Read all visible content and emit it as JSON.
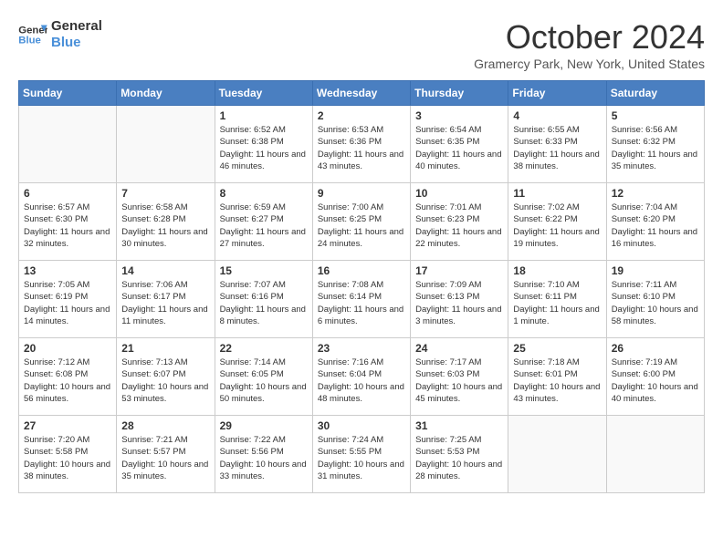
{
  "header": {
    "logo_line1": "General",
    "logo_line2": "Blue",
    "month": "October 2024",
    "location": "Gramercy Park, New York, United States"
  },
  "weekdays": [
    "Sunday",
    "Monday",
    "Tuesday",
    "Wednesday",
    "Thursday",
    "Friday",
    "Saturday"
  ],
  "weeks": [
    [
      {
        "day": "",
        "info": ""
      },
      {
        "day": "",
        "info": ""
      },
      {
        "day": "1",
        "info": "Sunrise: 6:52 AM\nSunset: 6:38 PM\nDaylight: 11 hours and 46 minutes."
      },
      {
        "day": "2",
        "info": "Sunrise: 6:53 AM\nSunset: 6:36 PM\nDaylight: 11 hours and 43 minutes."
      },
      {
        "day": "3",
        "info": "Sunrise: 6:54 AM\nSunset: 6:35 PM\nDaylight: 11 hours and 40 minutes."
      },
      {
        "day": "4",
        "info": "Sunrise: 6:55 AM\nSunset: 6:33 PM\nDaylight: 11 hours and 38 minutes."
      },
      {
        "day": "5",
        "info": "Sunrise: 6:56 AM\nSunset: 6:32 PM\nDaylight: 11 hours and 35 minutes."
      }
    ],
    [
      {
        "day": "6",
        "info": "Sunrise: 6:57 AM\nSunset: 6:30 PM\nDaylight: 11 hours and 32 minutes."
      },
      {
        "day": "7",
        "info": "Sunrise: 6:58 AM\nSunset: 6:28 PM\nDaylight: 11 hours and 30 minutes."
      },
      {
        "day": "8",
        "info": "Sunrise: 6:59 AM\nSunset: 6:27 PM\nDaylight: 11 hours and 27 minutes."
      },
      {
        "day": "9",
        "info": "Sunrise: 7:00 AM\nSunset: 6:25 PM\nDaylight: 11 hours and 24 minutes."
      },
      {
        "day": "10",
        "info": "Sunrise: 7:01 AM\nSunset: 6:23 PM\nDaylight: 11 hours and 22 minutes."
      },
      {
        "day": "11",
        "info": "Sunrise: 7:02 AM\nSunset: 6:22 PM\nDaylight: 11 hours and 19 minutes."
      },
      {
        "day": "12",
        "info": "Sunrise: 7:04 AM\nSunset: 6:20 PM\nDaylight: 11 hours and 16 minutes."
      }
    ],
    [
      {
        "day": "13",
        "info": "Sunrise: 7:05 AM\nSunset: 6:19 PM\nDaylight: 11 hours and 14 minutes."
      },
      {
        "day": "14",
        "info": "Sunrise: 7:06 AM\nSunset: 6:17 PM\nDaylight: 11 hours and 11 minutes."
      },
      {
        "day": "15",
        "info": "Sunrise: 7:07 AM\nSunset: 6:16 PM\nDaylight: 11 hours and 8 minutes."
      },
      {
        "day": "16",
        "info": "Sunrise: 7:08 AM\nSunset: 6:14 PM\nDaylight: 11 hours and 6 minutes."
      },
      {
        "day": "17",
        "info": "Sunrise: 7:09 AM\nSunset: 6:13 PM\nDaylight: 11 hours and 3 minutes."
      },
      {
        "day": "18",
        "info": "Sunrise: 7:10 AM\nSunset: 6:11 PM\nDaylight: 11 hours and 1 minute."
      },
      {
        "day": "19",
        "info": "Sunrise: 7:11 AM\nSunset: 6:10 PM\nDaylight: 10 hours and 58 minutes."
      }
    ],
    [
      {
        "day": "20",
        "info": "Sunrise: 7:12 AM\nSunset: 6:08 PM\nDaylight: 10 hours and 56 minutes."
      },
      {
        "day": "21",
        "info": "Sunrise: 7:13 AM\nSunset: 6:07 PM\nDaylight: 10 hours and 53 minutes."
      },
      {
        "day": "22",
        "info": "Sunrise: 7:14 AM\nSunset: 6:05 PM\nDaylight: 10 hours and 50 minutes."
      },
      {
        "day": "23",
        "info": "Sunrise: 7:16 AM\nSunset: 6:04 PM\nDaylight: 10 hours and 48 minutes."
      },
      {
        "day": "24",
        "info": "Sunrise: 7:17 AM\nSunset: 6:03 PM\nDaylight: 10 hours and 45 minutes."
      },
      {
        "day": "25",
        "info": "Sunrise: 7:18 AM\nSunset: 6:01 PM\nDaylight: 10 hours and 43 minutes."
      },
      {
        "day": "26",
        "info": "Sunrise: 7:19 AM\nSunset: 6:00 PM\nDaylight: 10 hours and 40 minutes."
      }
    ],
    [
      {
        "day": "27",
        "info": "Sunrise: 7:20 AM\nSunset: 5:58 PM\nDaylight: 10 hours and 38 minutes."
      },
      {
        "day": "28",
        "info": "Sunrise: 7:21 AM\nSunset: 5:57 PM\nDaylight: 10 hours and 35 minutes."
      },
      {
        "day": "29",
        "info": "Sunrise: 7:22 AM\nSunset: 5:56 PM\nDaylight: 10 hours and 33 minutes."
      },
      {
        "day": "30",
        "info": "Sunrise: 7:24 AM\nSunset: 5:55 PM\nDaylight: 10 hours and 31 minutes."
      },
      {
        "day": "31",
        "info": "Sunrise: 7:25 AM\nSunset: 5:53 PM\nDaylight: 10 hours and 28 minutes."
      },
      {
        "day": "",
        "info": ""
      },
      {
        "day": "",
        "info": ""
      }
    ]
  ]
}
